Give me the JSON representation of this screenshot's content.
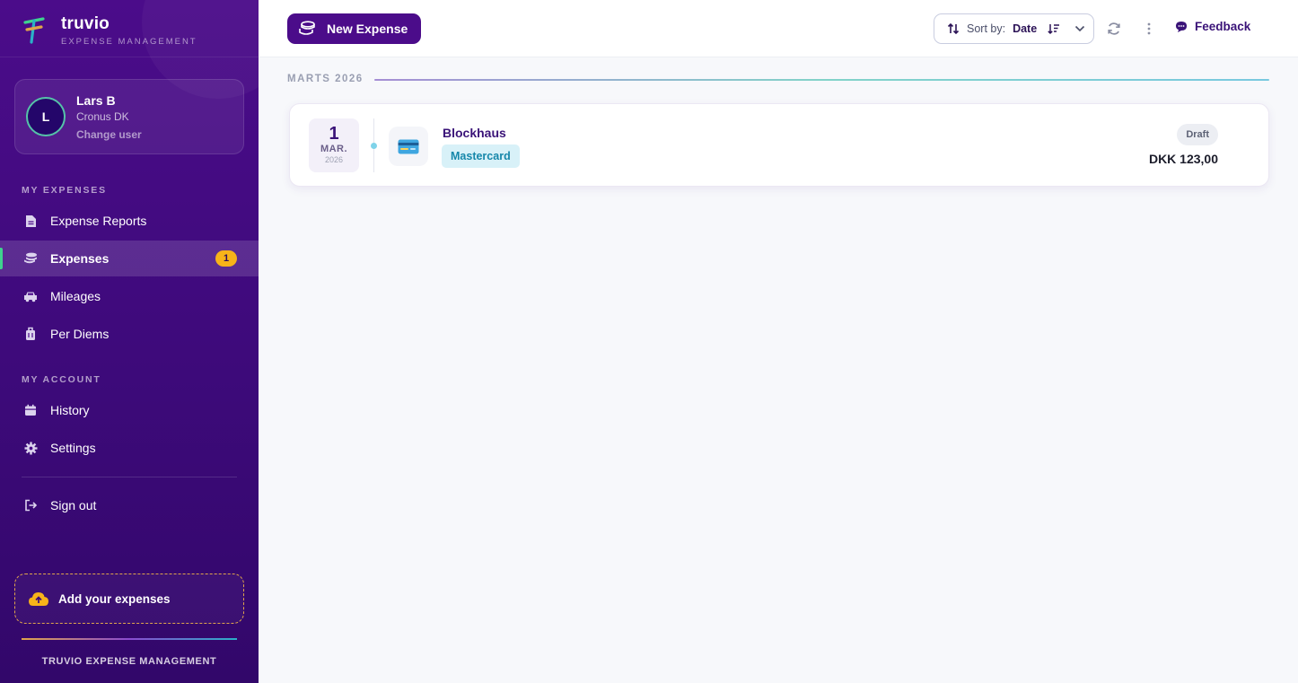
{
  "brand": {
    "name": "truvio",
    "tagline": "EXPENSE MANAGEMENT"
  },
  "user": {
    "initial": "L",
    "name": "Lars B",
    "company": "Cronus DK",
    "change_label": "Change user"
  },
  "sidebar": {
    "my_expenses_label": "MY EXPENSES",
    "items": [
      {
        "label": "Expense Reports",
        "icon": "document-icon"
      },
      {
        "label": "Expenses",
        "icon": "coins-icon",
        "badge": "1",
        "active": true
      },
      {
        "label": "Mileages",
        "icon": "car-icon"
      },
      {
        "label": "Per Diems",
        "icon": "suitcase-icon"
      }
    ],
    "my_account_label": "MY ACCOUNT",
    "account_items": [
      {
        "label": "History",
        "icon": "calendar-icon"
      },
      {
        "label": "Settings",
        "icon": "gear-icon"
      }
    ],
    "sign_out_label": "Sign out",
    "add_expenses_label": "Add your expenses",
    "footer": "TRUVIO EXPENSE MANAGEMENT"
  },
  "toolbar": {
    "new_expense_label": "New Expense",
    "sort_prefix": "Sort by:",
    "sort_value": "Date",
    "feedback_label": "Feedback"
  },
  "groups": [
    {
      "month_label": "MARTS 2026",
      "expenses": [
        {
          "day": "1",
          "month": "MAR.",
          "year": "2026",
          "merchant": "Blockhaus",
          "payment_tag": "Mastercard",
          "status": "Draft",
          "amount": "DKK 123,00"
        }
      ]
    }
  ],
  "colors": {
    "sidebar_bg": "#4b0c8a",
    "accent_green": "#3fd28e",
    "badge_yellow": "#f8b319",
    "tag_bg": "#d8f1f8",
    "tag_text": "#1687aa"
  }
}
